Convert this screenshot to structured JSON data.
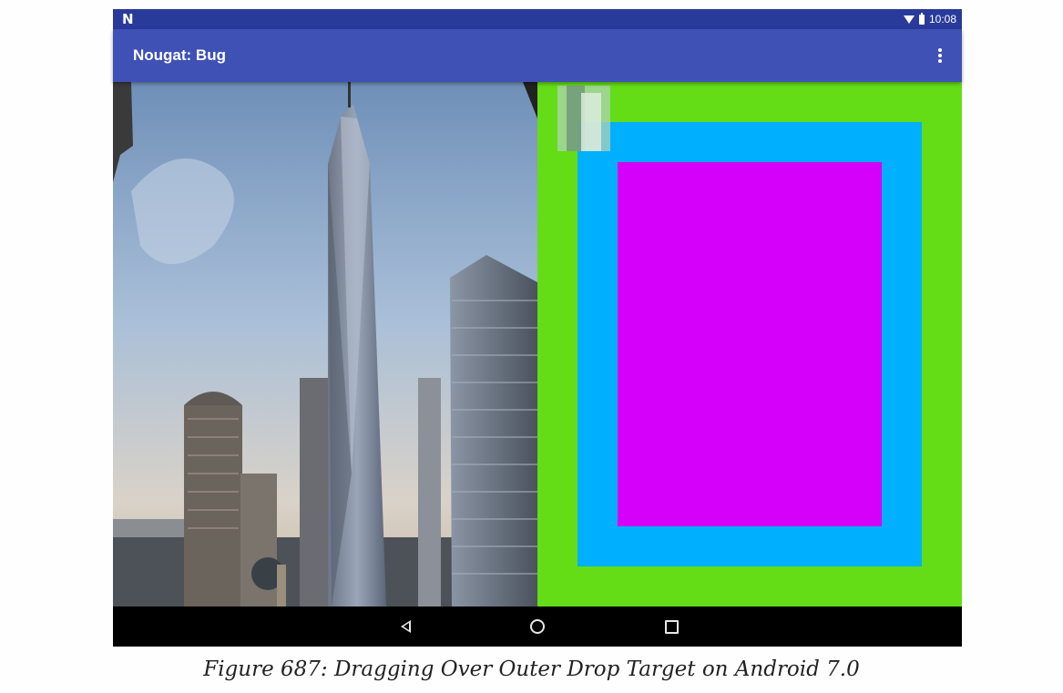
{
  "status_bar": {
    "notification_icon": "N",
    "icons": [
      "wifi-icon",
      "battery-icon"
    ],
    "time": "10:08"
  },
  "app_bar": {
    "title": "Nougat: Bug",
    "overflow_icon": "more-vert-icon"
  },
  "content": {
    "image_description_icon": "skyscraper-photo",
    "drop_targets": [
      {
        "name": "outer",
        "color": "#64dd17"
      },
      {
        "name": "middle",
        "color": "#00b0ff"
      },
      {
        "name": "inner",
        "color": "#d500f9"
      }
    ],
    "drag_shadow_icon": "drag-shadow-thumbnail"
  },
  "nav_bar": {
    "icons": [
      "back-icon",
      "home-icon",
      "recents-icon"
    ]
  },
  "caption": "Figure 687: Dragging Over Outer Drop Target on Android 7.0",
  "colors": {
    "status_bar": "#2a3a9a",
    "app_bar": "#3f51b5",
    "nav_bar": "#000000"
  }
}
